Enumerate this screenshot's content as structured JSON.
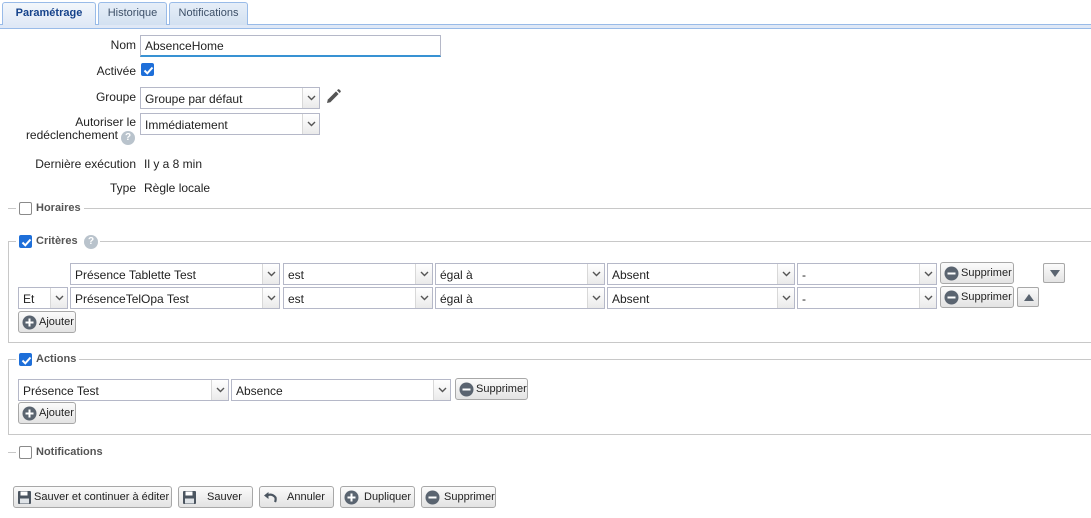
{
  "tabs": [
    {
      "label": "Paramétrage",
      "active": true
    },
    {
      "label": "Historique",
      "active": false
    },
    {
      "label": "Notifications",
      "active": false
    }
  ],
  "form": {
    "name_label": "Nom",
    "name_value": "AbsenceHome",
    "enabled_label": "Activée",
    "enabled_checked": true,
    "group_label": "Groupe",
    "group_value": "Groupe par défaut",
    "retrigger_label_1": "Autoriser le",
    "retrigger_label_2": "redéclenchement",
    "retrigger_value": "Immédiatement",
    "last_run_label": "Dernière exécution",
    "last_run_value": "Il y a 8 min",
    "type_label": "Type",
    "type_value": "Règle locale"
  },
  "sections": {
    "schedules": {
      "title": "Horaires",
      "checked": false
    },
    "criteria": {
      "title": "Critères",
      "checked": true
    },
    "actions": {
      "title": "Actions",
      "checked": true
    },
    "notifications": {
      "title": "Notifications",
      "checked": false
    }
  },
  "criteria_rows": [
    {
      "connector": "",
      "device": "Présence Tablette Test",
      "verb": "est",
      "operator": "égal à",
      "value": "Absent",
      "extra": "-",
      "delete_label": "Supprimer"
    },
    {
      "connector": "Et",
      "device": "PrésenceTelOpa Test",
      "verb": "est",
      "operator": "égal à",
      "value": "Absent",
      "extra": "-",
      "delete_label": "Supprimer"
    }
  ],
  "criteria_add_label": "Ajouter",
  "action_rows": [
    {
      "device": "Présence Test",
      "value": "Absence",
      "delete_label": "Supprimer"
    }
  ],
  "actions_add_label": "Ajouter",
  "footer": {
    "save_continue": "Sauver et continuer à éditer",
    "save": "Sauver",
    "cancel": "Annuler",
    "duplicate": "Dupliquer",
    "delete": "Supprimer"
  },
  "colors": {
    "accent": "#1e6fd9",
    "tab_border": "#99bbe8",
    "tab_active_text": "#15428b"
  }
}
